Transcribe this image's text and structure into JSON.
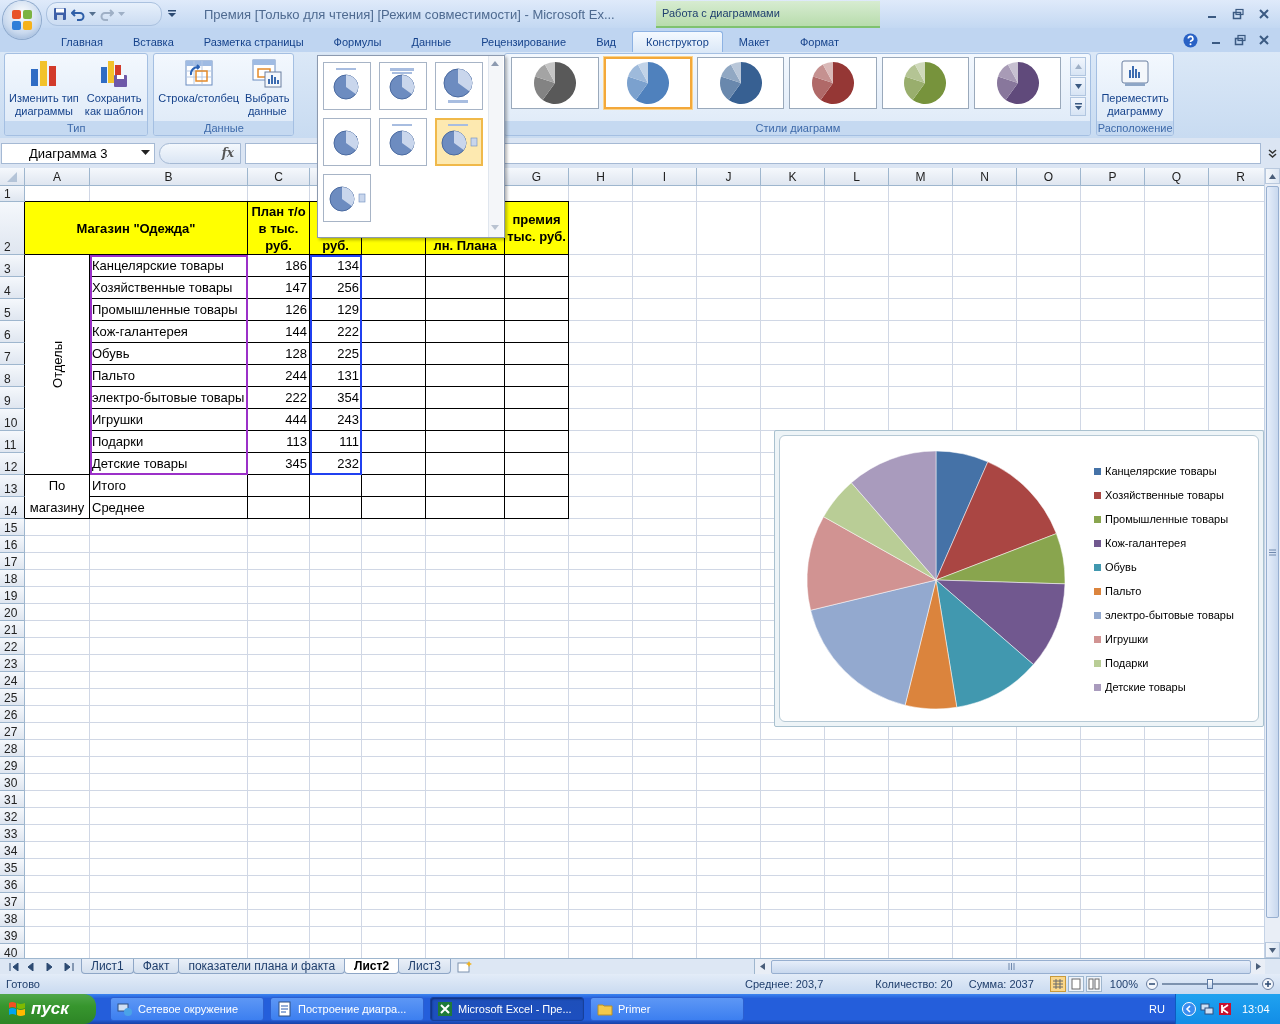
{
  "window": {
    "title": "Премия  [Только для чтения]  [Режим совместимости] - Microsoft Ex...",
    "tool_group": "Работа с диаграммами"
  },
  "ribbon_tabs": [
    {
      "label": "Главная",
      "selected": false
    },
    {
      "label": "Вставка",
      "selected": false
    },
    {
      "label": "Разметка страницы",
      "selected": false
    },
    {
      "label": "Формулы",
      "selected": false
    },
    {
      "label": "Данные",
      "selected": false
    },
    {
      "label": "Рецензирование",
      "selected": false
    },
    {
      "label": "Вид",
      "selected": false
    },
    {
      "label": "Конструктор",
      "selected": true
    },
    {
      "label": "Макет",
      "selected": false
    },
    {
      "label": "Формат",
      "selected": false
    }
  ],
  "ribbon_groups": [
    {
      "kind": "buttons",
      "title": "Тип",
      "buttons": [
        {
          "kind": "change_type",
          "label": "Изменить тип\nдиаграммы"
        },
        {
          "kind": "save_template",
          "label": "Сохранить\nкак шаблон"
        }
      ]
    },
    {
      "kind": "buttons",
      "title": "Данные",
      "buttons": [
        {
          "kind": "switch",
          "label": "Строка/столбец"
        },
        {
          "kind": "select_data",
          "label": "Выбрать\nданные"
        }
      ]
    },
    {
      "kind": "gallery",
      "title": "Стили диаграмм",
      "styles": [
        {
          "selected": false,
          "color": "#595959"
        },
        {
          "selected": true,
          "color": "#4f81bd"
        },
        {
          "selected": false,
          "color": "#376092"
        },
        {
          "selected": false,
          "color": "#953735"
        },
        {
          "selected": false,
          "color": "#77933c"
        },
        {
          "selected": false,
          "color": "#604a7b"
        }
      ]
    },
    {
      "kind": "buttons",
      "title": "Расположение",
      "buttons": [
        {
          "kind": "move",
          "label": "Переместить\nдиаграмму"
        }
      ]
    }
  ],
  "layout_gallery": {
    "layouts": [
      {
        "selected": false
      },
      {
        "selected": false
      },
      {
        "selected": false
      },
      {
        "selected": false
      },
      {
        "selected": false
      },
      {
        "selected": true
      },
      {
        "selected": false
      }
    ]
  },
  "formula_bar": {
    "name_box": "Диаграмма 3",
    "function_button": "fx"
  },
  "sheet": {
    "columns_left": [
      "A",
      "B",
      "C"
    ],
    "columns_right": [
      "G",
      "H",
      "I",
      "J",
      "K",
      "L",
      "M",
      "N",
      "O",
      "P",
      "Q",
      "R"
    ],
    "row_numbers": [
      "1",
      "2",
      "3",
      "4",
      "5",
      "6",
      "7",
      "8",
      "9",
      "10",
      "11",
      "12",
      "13",
      "14",
      "15",
      "16",
      "17",
      "18",
      "19",
      "20",
      "21",
      "22",
      "23",
      "24",
      "25",
      "26",
      "27",
      "28",
      "29",
      "30",
      "31",
      "32",
      "33",
      "34",
      "35",
      "36",
      "37",
      "38",
      "39",
      "40"
    ],
    "header": {
      "title": "Магазин \"Одежда\"",
      "plan": "План т/о в тыс. руб.",
      "fact": "руб.",
      "execution": "лн. Плана",
      "bonus": "премия тыс. руб."
    },
    "group_label": "Отделы",
    "rows": [
      {
        "name": "Канцелярские товары",
        "plan": "186",
        "fact": "134"
      },
      {
        "name": "Хозяйственные товары",
        "plan": "147",
        "fact": "256"
      },
      {
        "name": "Промышленные товары",
        "plan": "126",
        "fact": "129"
      },
      {
        "name": "Кож-галантерея",
        "plan": "144",
        "fact": "222"
      },
      {
        "name": "Обувь",
        "plan": "128",
        "fact": "225"
      },
      {
        "name": "Пальто",
        "plan": "244",
        "fact": "131"
      },
      {
        "name": "электро-бытовые товары",
        "plan": "222",
        "fact": "354"
      },
      {
        "name": "Игрушки",
        "plan": "444",
        "fact": "243"
      },
      {
        "name": "Подарки",
        "plan": "113",
        "fact": "111"
      },
      {
        "name": "Детские товары",
        "plan": "345",
        "fact": "232"
      }
    ],
    "summary_label": "По магазину",
    "summary_rows": [
      "Итого",
      "Среднее"
    ]
  },
  "chart": {
    "legend": [
      {
        "label": "Канцелярские товары",
        "color": "#4572a7"
      },
      {
        "label": "Хозяйственные товары",
        "color": "#aa4643"
      },
      {
        "label": "Промышленные товары",
        "color": "#89a54e"
      },
      {
        "label": "Кож-галантерея",
        "color": "#71588f"
      },
      {
        "label": "Обувь",
        "color": "#4198af"
      },
      {
        "label": "Пальто",
        "color": "#db843d"
      },
      {
        "label": "электро-бытовые товары",
        "color": "#93a9cf"
      },
      {
        "label": "Игрушки",
        "color": "#d19392"
      },
      {
        "label": "Подарки",
        "color": "#b9cd96"
      },
      {
        "label": "Детские товары",
        "color": "#a99bbd"
      }
    ]
  },
  "sheet_tabs": [
    {
      "label": "Лист1",
      "selected": false
    },
    {
      "label": "Факт",
      "selected": false
    },
    {
      "label": "показатели плана и факта",
      "selected": false
    },
    {
      "label": "Лист2",
      "selected": true
    },
    {
      "label": "Лист3",
      "selected": false
    }
  ],
  "status_bar": {
    "mode": "Готово",
    "average": "Среднее: 203,7",
    "count": "Количество: 20",
    "sum": "Сумма: 2037",
    "zoom": "100%",
    "zoom_slider": {
      "level": 0.5
    }
  },
  "taskbar": {
    "start": "пуск",
    "tasks": [
      {
        "label": "Сетевое окружение",
        "selected": false
      },
      {
        "label": "Построение диагра...",
        "selected": false
      },
      {
        "label": "Microsoft Excel - Пре...",
        "selected": true
      },
      {
        "label": "Primer",
        "selected": false
      }
    ],
    "language": "RU",
    "clock": "13:04"
  }
}
